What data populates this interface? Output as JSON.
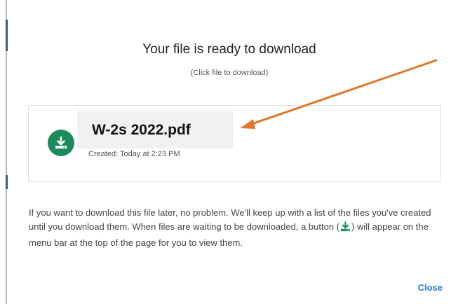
{
  "dialog": {
    "title": "Your file is ready to download",
    "subtitle": "(Click file to download)",
    "close_label": "Close"
  },
  "file": {
    "name": "W-2s 2022.pdf",
    "created": "Created: Today at 2:23 PM",
    "icon": "download-icon"
  },
  "info": {
    "before_icon": "If you want to download this file later, no problem. We'll keep up with a list of the files you've created until you download them. When files are waiting to be downloaded, a button (",
    "after_icon": ") will appear on the menu bar at the top of the page for you to view them."
  },
  "colors": {
    "accent": "#1e8a5c",
    "link": "#2a7bd3",
    "annotation_arrow": "#e0782a"
  }
}
